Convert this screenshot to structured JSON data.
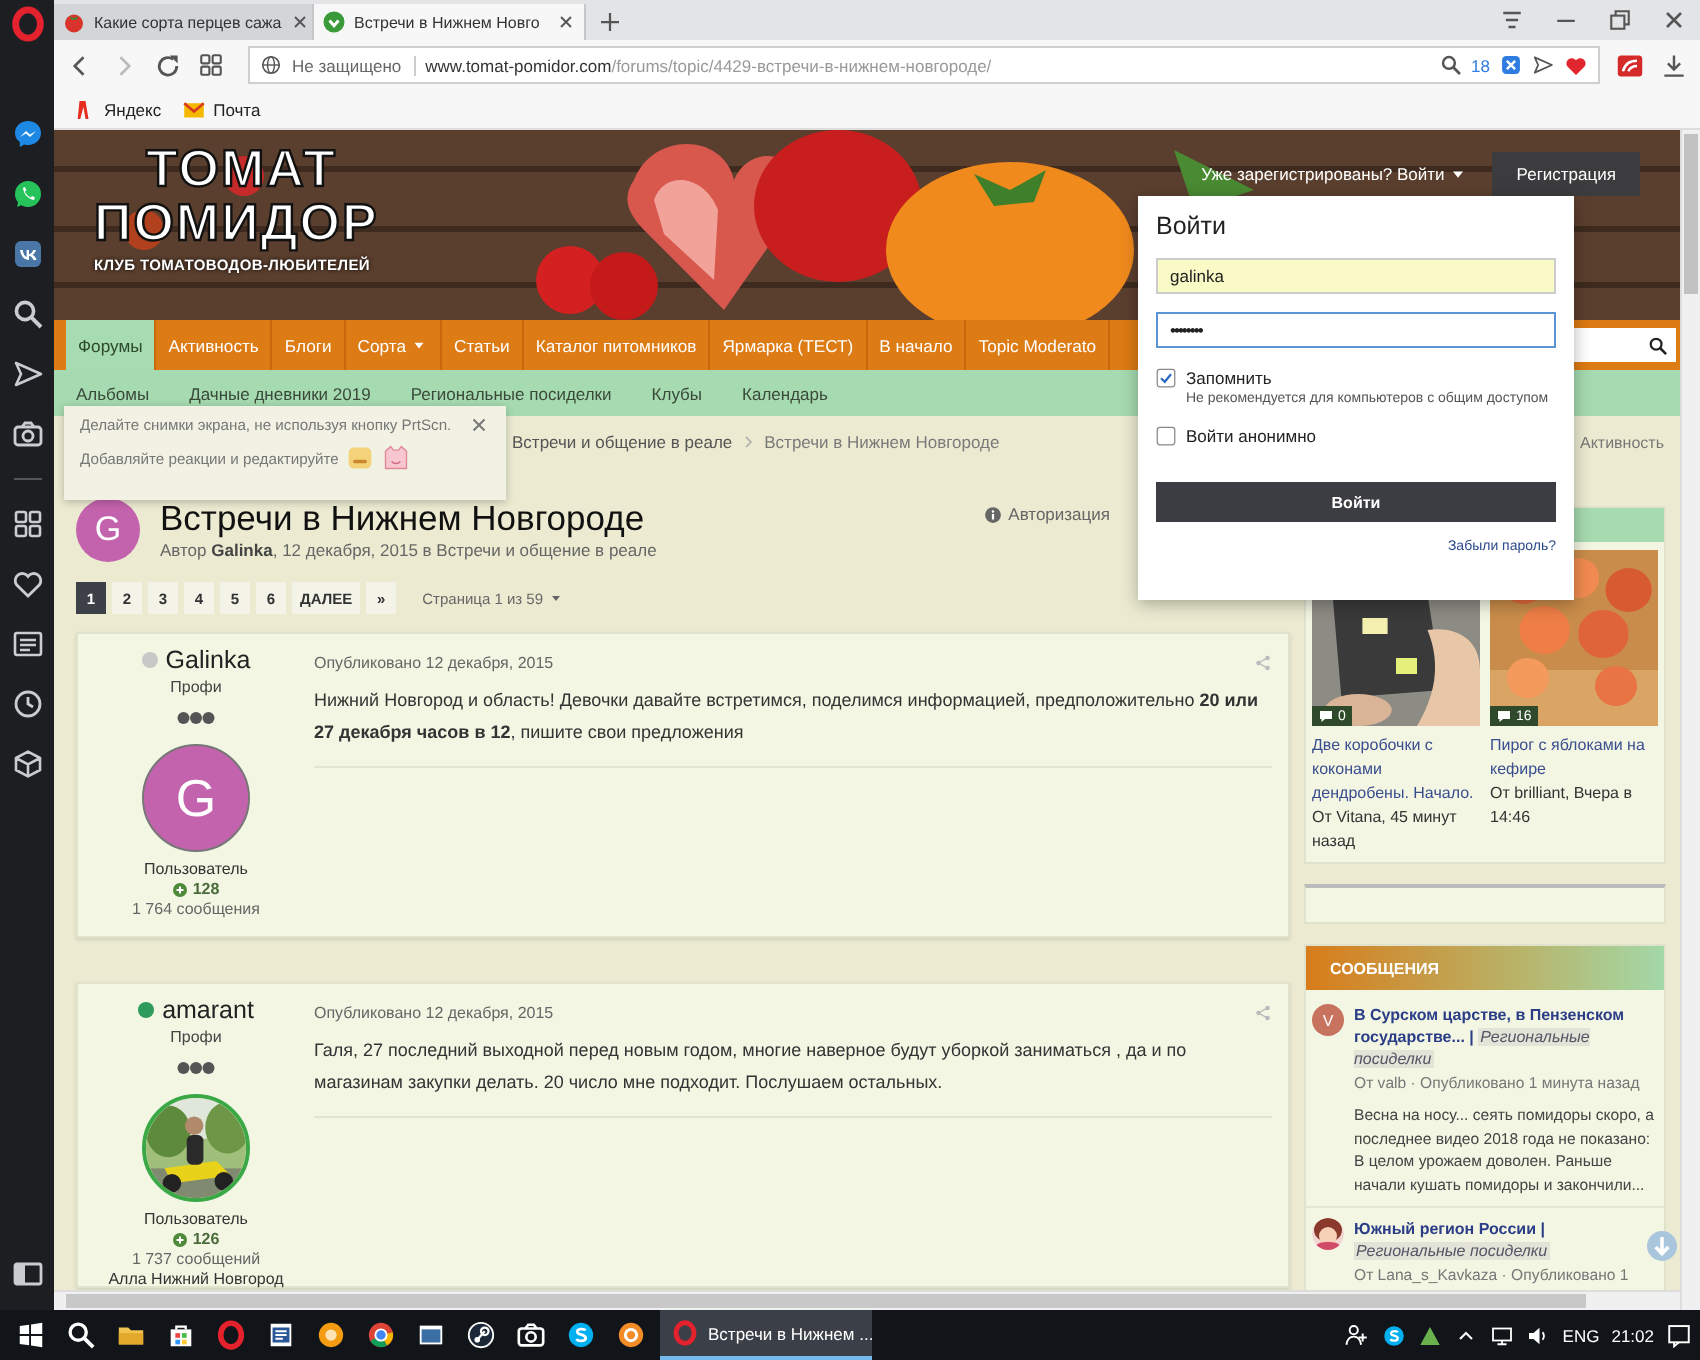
{
  "browser": {
    "tabs": [
      {
        "title": "Какие сорта перцев сажа",
        "selected": false
      },
      {
        "title": "Встречи в Нижнем Новго",
        "selected": true
      }
    ],
    "security": "Не защищено",
    "url_domain": "www.tomat-pomidor.com",
    "url_path": "/forums/topic/4429-встречи-в-нижнем-новгороде/",
    "blocked_count": "18",
    "bookmarks": [
      {
        "label": "Яндекс"
      },
      {
        "label": "Почта"
      }
    ]
  },
  "header": {
    "logo_line_1": "ТОМАТ",
    "logo_line_2": "ПОМИДОР",
    "logo_tagline": "КЛУБ ТОМАТОВОДОВ-ЛЮБИТЕЛЕЙ",
    "sign_in": "Уже зарегистрированы? Войти",
    "register": "Регистрация"
  },
  "nav": [
    {
      "label": "Форумы",
      "selected": true,
      "has_menu": false
    },
    {
      "label": "Активность",
      "selected": false,
      "has_menu": false
    },
    {
      "label": "Блоги",
      "selected": false,
      "has_menu": false
    },
    {
      "label": "Сорта",
      "selected": false,
      "has_menu": true
    },
    {
      "label": "Статьи",
      "selected": false,
      "has_menu": false
    },
    {
      "label": "Каталог питомников",
      "selected": false,
      "has_menu": false
    },
    {
      "label": "Ярмарка (ТЕСТ)",
      "selected": false,
      "has_menu": false
    },
    {
      "label": "В начало",
      "selected": false,
      "has_menu": false
    },
    {
      "label": "Topic Moderato",
      "selected": false,
      "has_menu": false
    }
  ],
  "subnav": [
    "Альбомы",
    "Дачные дневники 2019",
    "Региональные посиделки",
    "Клубы",
    "Календарь"
  ],
  "breadcrumb": [
    "Встречи и общение в реале",
    "Встречи в Нижнем Новгороде"
  ],
  "activity_link": "Активность",
  "topic": {
    "avatar": {
      "letter": "G",
      "color": "#c463ad"
    },
    "title": "Встречи в Нижнем Новгороде",
    "byline": "Автор **Galinka**, 12 декабря, 2015 в Встречи и общение в реале",
    "sign_in_notice": "Авторизация"
  },
  "pagination": {
    "pages": [
      {
        "label": "1",
        "selected": true
      },
      {
        "label": "2",
        "selected": false
      },
      {
        "label": "3",
        "selected": false
      },
      {
        "label": "4",
        "selected": false
      },
      {
        "label": "5",
        "selected": false
      },
      {
        "label": "6",
        "selected": false
      }
    ],
    "next": "ДАЛЕЕ",
    "last": "»",
    "info": "Страница 1 из 59"
  },
  "posts": [
    {
      "author": "Galinka",
      "online": false,
      "rank": "Профи",
      "avatar": {
        "kind": "letter",
        "letter": "G",
        "color": "#c463ad"
      },
      "group": "Пользователь",
      "reputation": "128",
      "post_count": "1 764 сообщения",
      "date": "Опубликовано 12 декабря, 2015",
      "body": "Нижний Новгород и область! Девочки давайте встретимся, поделимся информацией, предположительно **20 или 27 декабря часов в 12**, пишите свои предложения"
    },
    {
      "author": "amarant",
      "online": true,
      "rank": "Профи",
      "group": "Пользователь",
      "reputation": "126",
      "post_count": "1 737 сообщений",
      "location": "Алла Нижний Новгород",
      "date": "Опубликовано 12 декабря, 2015",
      "body": "Галя, 27 последний выходной перед новым годом, многие наверное будут уборкой заниматься , да и по магазинам закупки делать. 20 число мне подходит. Послушаем остальных."
    }
  ],
  "gallery": [
    {
      "comments": "0",
      "title": "Две коробочки с коконами дендробены. Начало.",
      "meta": "От Vitana, 45 минут назад"
    },
    {
      "comments": "16",
      "title": "Пирог с яблоками на кефире",
      "meta": "От brilliant, Вчера в 14:46"
    }
  ],
  "messages": {
    "title": "СООБЩЕНИЯ",
    "items": [
      {
        "avatar": {
          "kind": "letter",
          "letter": "V",
          "color": "#c8735e"
        },
        "title": "В Сурском царстве, в Пензенском государстве... |",
        "tag": "Региональные посиделки",
        "meta": "От valb · Опубликовано 1 минута назад",
        "excerpt": "Весна на носу... сеять помидоры скоро, а последнее видео 2018 года не показано: В целом урожаем доволен. Раньше начали кушать помидоры и закончили..."
      },
      {
        "title": "Южный регион России |",
        "tag": "Региональные посиделки",
        "meta": "От Lana_s_Kavkaza · Опубликовано 1"
      }
    ]
  },
  "login": {
    "title": "Войти",
    "username": "galinka",
    "password": "••••••••",
    "remember": {
      "label": "Запомнить",
      "checked": true,
      "note": "Не рекомендуется для компьютеров с общим доступом"
    },
    "anonymous": {
      "label": "Войти анонимно",
      "checked": false
    },
    "submit": "Войти",
    "forgot": "Забыли пароль?"
  },
  "tip": {
    "line_1": "Делайте снимки экрана, не используя кнопку PrtScn.",
    "line_2": "Добавляйте реакции и редактируйте"
  },
  "taskbar": {
    "window": "Встречи в Нижнем ...",
    "language": "ENG",
    "time": "21:02"
  }
}
